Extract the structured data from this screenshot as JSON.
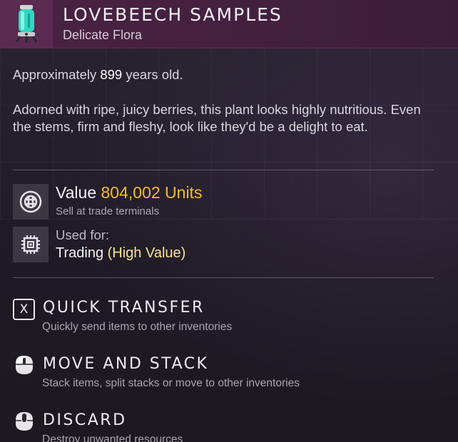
{
  "item": {
    "title": "LOVEBEECH SAMPLES",
    "category": "Delicate Flora",
    "icon": "specimen-canister-icon"
  },
  "description": {
    "age_prefix": "Approximately ",
    "age_value": "899",
    "age_suffix": " years old.",
    "flavor_text": "Adorned with ripe, juicy berries, this plant looks highly nutritious. Even the stems, firm and fleshy, look like they'd be a delight to eat."
  },
  "value": {
    "label": "Value",
    "amount": "804,002 Units",
    "note": "Sell at trade terminals",
    "icon": "units-currency-icon"
  },
  "used_for": {
    "label": "Used for:",
    "value": "Trading",
    "tag": "(High Value)",
    "icon": "trade-chip-icon"
  },
  "actions": [
    {
      "key_label": "X",
      "title": "QUICK TRANSFER",
      "subtitle": "Quickly send items to other inventories",
      "icon": "x-key-icon"
    },
    {
      "title": "MOVE AND STACK",
      "subtitle": "Stack items, split stacks or move to other inventories",
      "icon": "mouse-left-click-icon"
    },
    {
      "title": "DISCARD",
      "subtitle": "Destroy unwanted resources",
      "icon": "mouse-middle-click-icon"
    }
  ],
  "colors": {
    "header": "#4a2244",
    "value_accent": "#f3bb2a",
    "tag_accent": "#f5e48a"
  }
}
